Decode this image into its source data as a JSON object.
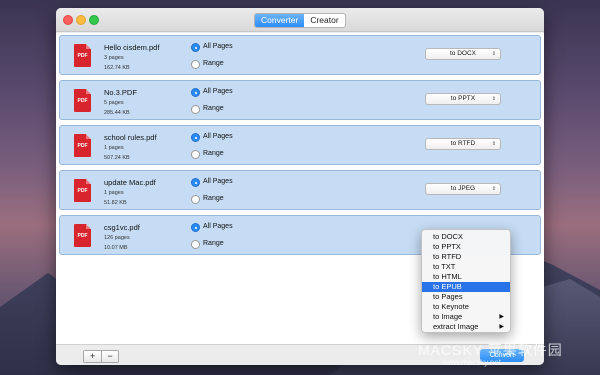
{
  "window": {
    "tabs": [
      {
        "label": "Converter",
        "active": true
      },
      {
        "label": "Creator",
        "active": false
      }
    ]
  },
  "files": [
    {
      "name": "Hello cisdem.pdf",
      "pages": "3 pages",
      "size": "162.74 KB",
      "format": "to DOCX",
      "all_pages_selected": true
    },
    {
      "name": "No.3.PDF",
      "pages": "5 pages",
      "size": "285.44 KB",
      "format": "to PPTX",
      "all_pages_selected": true
    },
    {
      "name": "school rules.pdf",
      "pages": "1 pages",
      "size": "507.24 KB",
      "format": "to RTFD",
      "all_pages_selected": true
    },
    {
      "name": "update Mac.pdf",
      "pages": "1 pages",
      "size": "51.82 KB",
      "format": "to JPEG",
      "all_pages_selected": true
    },
    {
      "name": "csg1vc.pdf",
      "pages": "126 pages",
      "size": "10.07 MB",
      "format": "to EPUB",
      "all_pages_selected": true
    }
  ],
  "radio_labels": {
    "all_pages": "All Pages",
    "range": "Range"
  },
  "pdf_icon_text": "PDF",
  "format_menu": {
    "items": [
      "to DOCX",
      "to PPTX",
      "to RTFD",
      "to TXT",
      "to HTML",
      "to EPUB",
      "to Pages",
      "to Keynote",
      "to Image",
      "extract Image"
    ],
    "selected": "to EPUB",
    "submenu_items": [
      "to Image",
      "extract Image"
    ]
  },
  "bottom_bar": {
    "add_label": "+",
    "remove_label": "−",
    "convert_label": "Convert"
  },
  "watermark": {
    "line1": "MACSKY 苹果软件园",
    "line2": "www.macsky.net"
  },
  "colors": {
    "accent": "#2a8cf6",
    "row_bg": "#c5dcf4",
    "pdf_red": "#d8242c"
  }
}
